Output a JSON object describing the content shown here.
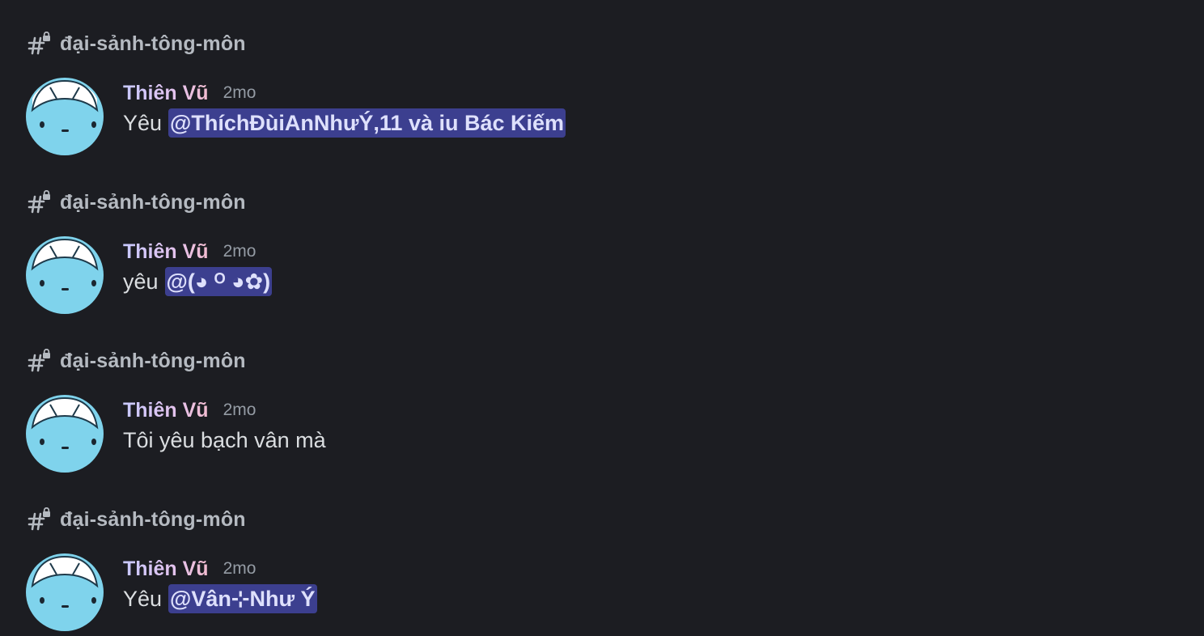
{
  "colors": {
    "background": "#1c1d22",
    "channel_text": "#b5bac1",
    "message_text": "#dbdee1",
    "timestamp": "#949ba4",
    "mention_bg": "#3c3f8f",
    "mention_text": "#dee0fc",
    "avatar_bg": "#7fd3ec"
  },
  "results": [
    {
      "channel": {
        "icon": "hashtag-lock-icon",
        "name": "đại-sảnh-tông-môn"
      },
      "author": "Thiên Vũ",
      "timestamp": "2mo",
      "text_prefix": "Yêu",
      "mention": "@ThíchĐùiAnNhưÝ,11 và iu Bác Kiếm"
    },
    {
      "channel": {
        "icon": "hashtag-lock-icon",
        "name": "đại-sảnh-tông-môn"
      },
      "author": "Thiên Vũ",
      "timestamp": "2mo",
      "text_prefix": "yêu",
      "mention": "@(◕ ᴼ ◕✿)"
    },
    {
      "channel": {
        "icon": "hashtag-lock-icon",
        "name": "đại-sảnh-tông-môn"
      },
      "author": "Thiên Vũ",
      "timestamp": "2mo",
      "text": "Tôi yêu bạch vân mà"
    },
    {
      "channel": {
        "icon": "hashtag-lock-icon",
        "name": "đại-sảnh-tông-môn"
      },
      "author": "Thiên Vũ",
      "timestamp": "2mo",
      "text_prefix": "Yêu",
      "mention": "@Vân⊹Như Ý"
    }
  ]
}
